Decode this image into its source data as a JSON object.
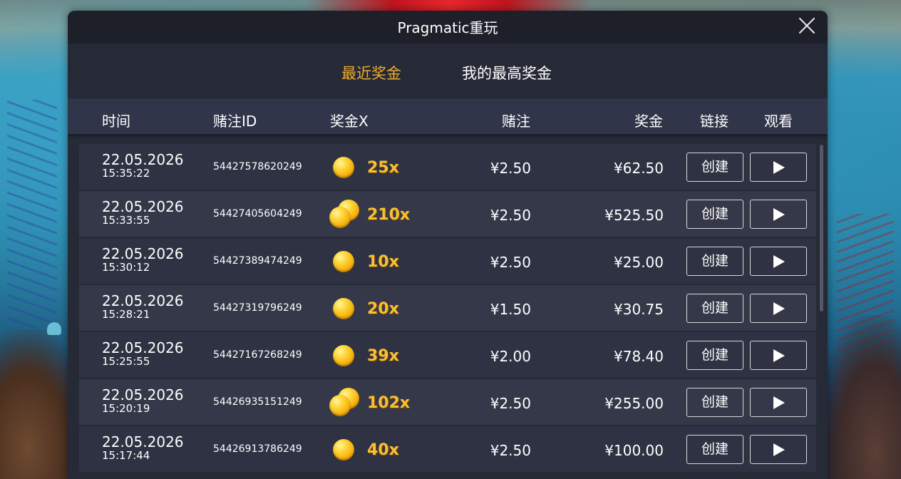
{
  "dialog": {
    "title": "Pragmatic重玩",
    "tabs": [
      {
        "label": "最近奖金",
        "active": true
      },
      {
        "label": "我的最高奖金",
        "active": false
      }
    ],
    "columns": {
      "time": "时间",
      "bet_id": "赌注ID",
      "multiplier": "奖金X",
      "bet": "赌注",
      "win": "奖金",
      "link": "链接",
      "watch": "观看"
    },
    "create_label": "创建",
    "rows": [
      {
        "date": "22.05.2026",
        "time": "15:35:22",
        "bet_id": "54427578620249",
        "multiplier": "25x",
        "bet": "¥2.50",
        "win": "¥62.50",
        "coin": "single"
      },
      {
        "date": "22.05.2026",
        "time": "15:33:55",
        "bet_id": "54427405604249",
        "multiplier": "210x",
        "bet": "¥2.50",
        "win": "¥525.50",
        "coin": "double"
      },
      {
        "date": "22.05.2026",
        "time": "15:30:12",
        "bet_id": "54427389474249",
        "multiplier": "10x",
        "bet": "¥2.50",
        "win": "¥25.00",
        "coin": "single"
      },
      {
        "date": "22.05.2026",
        "time": "15:28:21",
        "bet_id": "54427319796249",
        "multiplier": "20x",
        "bet": "¥1.50",
        "win": "¥30.75",
        "coin": "single"
      },
      {
        "date": "22.05.2026",
        "time": "15:25:55",
        "bet_id": "54427167268249",
        "multiplier": "39x",
        "bet": "¥2.00",
        "win": "¥78.40",
        "coin": "single"
      },
      {
        "date": "22.05.2026",
        "time": "15:20:19",
        "bet_id": "54426935151249",
        "multiplier": "102x",
        "bet": "¥2.50",
        "win": "¥255.00",
        "coin": "double"
      },
      {
        "date": "22.05.2026",
        "time": "15:17:44",
        "bet_id": "54426913786249",
        "multiplier": "40x",
        "bet": "¥2.50",
        "win": "¥100.00",
        "coin": "single"
      }
    ]
  },
  "colors": {
    "accent_tab": "#f1ab2b",
    "multiplier_text": "#f7bf38",
    "dialog_bg": "#262a37"
  }
}
